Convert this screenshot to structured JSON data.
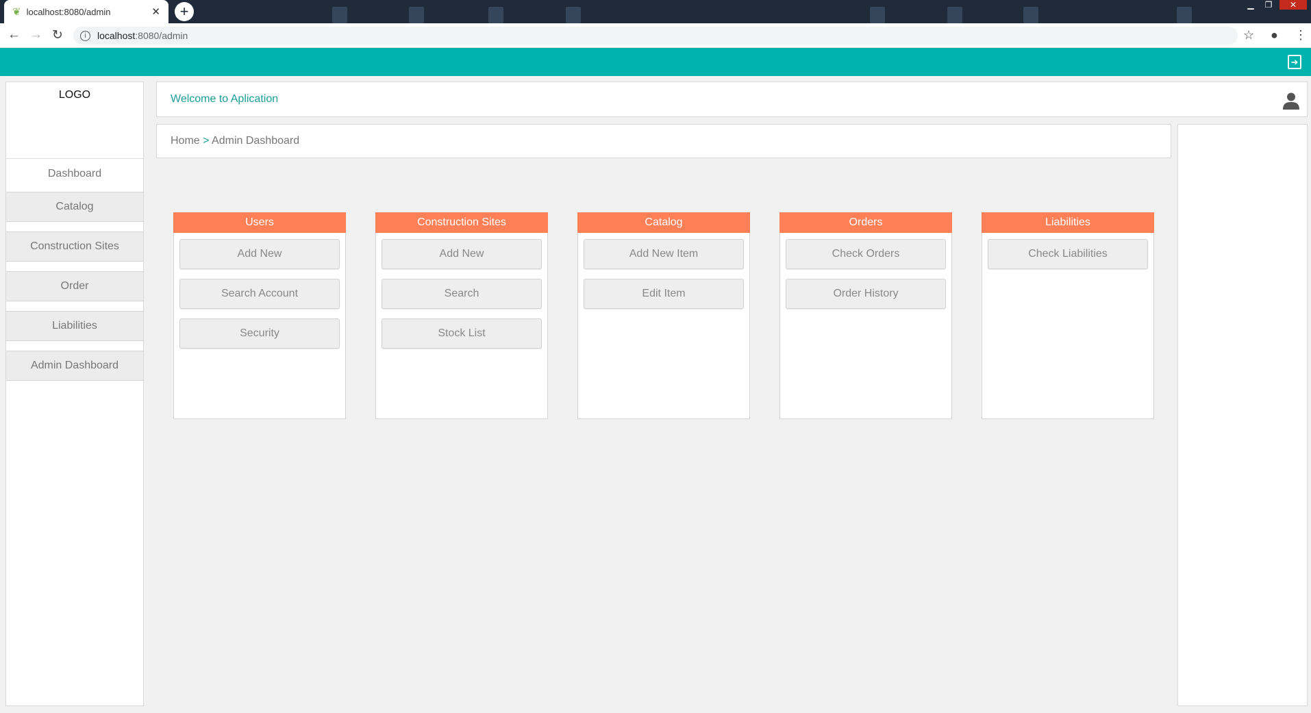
{
  "browser": {
    "tab_title": "localhost:8080/admin",
    "url_host": "localhost",
    "url_rest": ":8080/admin"
  },
  "app": {
    "accent_color": "#00b3ad",
    "card_header_color": "#ff7f57",
    "logo_text": "LOGO",
    "welcome_text": "Welcome to Aplication",
    "breadcrumb": {
      "home": "Home",
      "separator": ">",
      "current": "Admin Dashboard"
    }
  },
  "sidebar": {
    "active": "Dashboard",
    "items": [
      "Catalog",
      "Construction Sites",
      "Order",
      "Liabilities",
      "Admin Dashboard"
    ]
  },
  "cards": [
    {
      "title": "Users",
      "buttons": [
        "Add New",
        "Search Account",
        "Security"
      ]
    },
    {
      "title": "Construction Sites",
      "buttons": [
        "Add New",
        "Search",
        "Stock List"
      ]
    },
    {
      "title": "Catalog",
      "buttons": [
        "Add New Item",
        "Edit Item"
      ]
    },
    {
      "title": "Orders",
      "buttons": [
        "Check Orders",
        "Order History"
      ]
    },
    {
      "title": "Liabilities",
      "buttons": [
        "Check Liabilities"
      ]
    }
  ]
}
